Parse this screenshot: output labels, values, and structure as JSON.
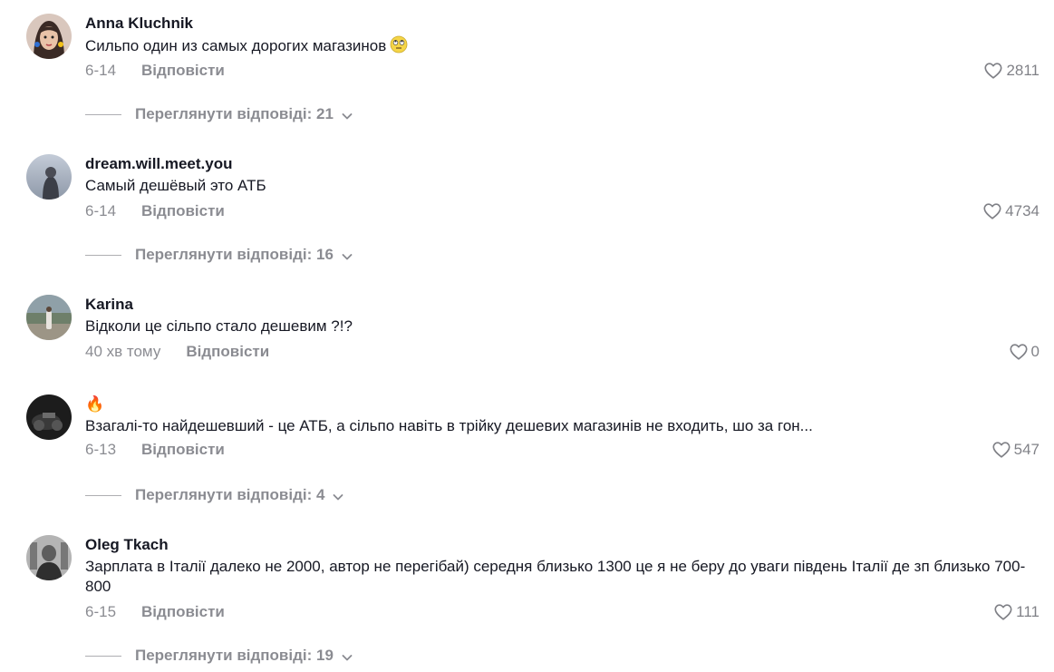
{
  "comments": [
    {
      "username": "Anna Kluchnik",
      "text": "Сильпо один из самых дорогих магазинов",
      "emoji": "eye-roll-emoji",
      "date": "6-14",
      "reply_label": "Відповісти",
      "likes": "2811",
      "view_replies": "Переглянути відповіді: 21"
    },
    {
      "username": "dream.will.meet.you",
      "text": "Самый дешёвый это АТБ",
      "date": "6-14",
      "reply_label": "Відповісти",
      "likes": "4734",
      "view_replies": "Переглянути відповіді: 16"
    },
    {
      "username": "Karina",
      "text": "Відколи це сільпо стало дешевим ?!?",
      "date": "40 хв тому",
      "reply_label": "Відповісти",
      "likes": "0"
    },
    {
      "username": "🔥",
      "text": "Взагалі-то найдешевший - це АТБ, а сільпо навіть в трійку дешевих магазинів не входить, шо за гон...",
      "date": "6-13",
      "reply_label": "Відповісти",
      "likes": "547",
      "view_replies": "Переглянути відповіді: 4"
    },
    {
      "username": "Oleg Tkach",
      "text": "Зарплата в Італії далеко не 2000, автор не перегібай) середня близько 1300 це я не беру до уваги південь Італії де зп близько 700-800",
      "date": "6-15",
      "reply_label": "Відповісти",
      "likes": "111",
      "view_replies": "Переглянути відповіді: 19"
    }
  ],
  "icons": {
    "like": "heart-outline-icon",
    "expand": "chevron-down-icon"
  }
}
